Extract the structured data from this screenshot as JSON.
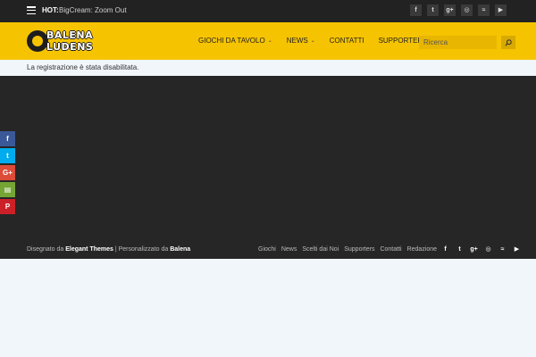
{
  "topbar": {
    "hot_label": "HOT:",
    "hot_text": "BigCream: Zoom Out",
    "social_icons": [
      "facebook-icon",
      "twitter-icon",
      "google-plus-icon",
      "instagram-icon",
      "rss-icon",
      "youtube-icon"
    ],
    "social_glyphs": [
      "f",
      "t",
      "g+",
      "◎",
      "≈",
      "▶"
    ]
  },
  "header": {
    "logo_line1": "BALENA",
    "logo_line2": "LUDENS",
    "nav": [
      {
        "label": "GIOCHI DA TAVOLO",
        "has_dropdown": true
      },
      {
        "label": "NEWS",
        "has_dropdown": true
      },
      {
        "label": "CONTATTI",
        "has_dropdown": false
      },
      {
        "label": "SUPPORTERS",
        "has_dropdown": false
      }
    ],
    "search_placeholder": "Ricerca"
  },
  "notice": "La registrazione è stata disabilitata.",
  "share_rail": [
    {
      "icon": "facebook-icon",
      "glyph": "f",
      "color": "#3b5998"
    },
    {
      "icon": "twitter-icon",
      "glyph": "t",
      "color": "#00aced"
    },
    {
      "icon": "google-plus-icon",
      "glyph": "G+",
      "color": "#dd4b39"
    },
    {
      "icon": "print-icon",
      "glyph": "▤",
      "color": "#75a535"
    },
    {
      "icon": "pinterest-icon",
      "glyph": "P",
      "color": "#cb2027"
    }
  ],
  "footer": {
    "credit_prefix": "Disegnato da",
    "credit_brand": "Elegant Themes",
    "credit_mid": "| Personalizzato da",
    "credit_author": "Balena",
    "links": [
      "Giochi",
      "News",
      "Scelti dai Noi",
      "Supporters",
      "Contatti",
      "Redazione"
    ],
    "social_icons": [
      "facebook-icon",
      "twitter-icon",
      "google-plus-icon",
      "instagram-icon",
      "rss-icon",
      "youtube-icon"
    ],
    "social_glyphs": [
      "f",
      "t",
      "g+",
      "◎",
      "≈",
      "▶"
    ]
  },
  "colors": {
    "brand_yellow": "#f6c300",
    "dark": "#222222"
  }
}
